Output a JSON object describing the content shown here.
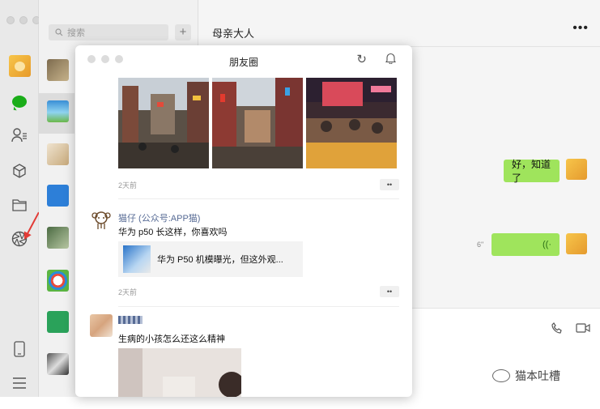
{
  "chatlist": {
    "search_placeholder": "搜索",
    "add_label": "+"
  },
  "main": {
    "title": "母亲大人",
    "more_label": "•••",
    "messages": [
      {
        "text": "好，知道了"
      },
      {
        "voice_duration": "6\""
      }
    ]
  },
  "moments": {
    "title": "朋友圈",
    "posts": [
      {
        "time": "2天前"
      },
      {
        "name": "猫仔 (公众号:APP猫)",
        "text": "华为 p50 长这样，你喜欢吗",
        "share_title": "华为 P50 机模曝光，但这外观...",
        "time": "2天前"
      },
      {
        "text": "生病的小孩怎么还这么精神"
      }
    ],
    "more_dots": "••"
  },
  "watermark": {
    "text": "猫本吐槽"
  },
  "colors": {
    "accent_green": "#1aad19",
    "bubble_green": "#9fe45c",
    "link_blue": "#576b95",
    "arrow_red": "#e23b36"
  }
}
